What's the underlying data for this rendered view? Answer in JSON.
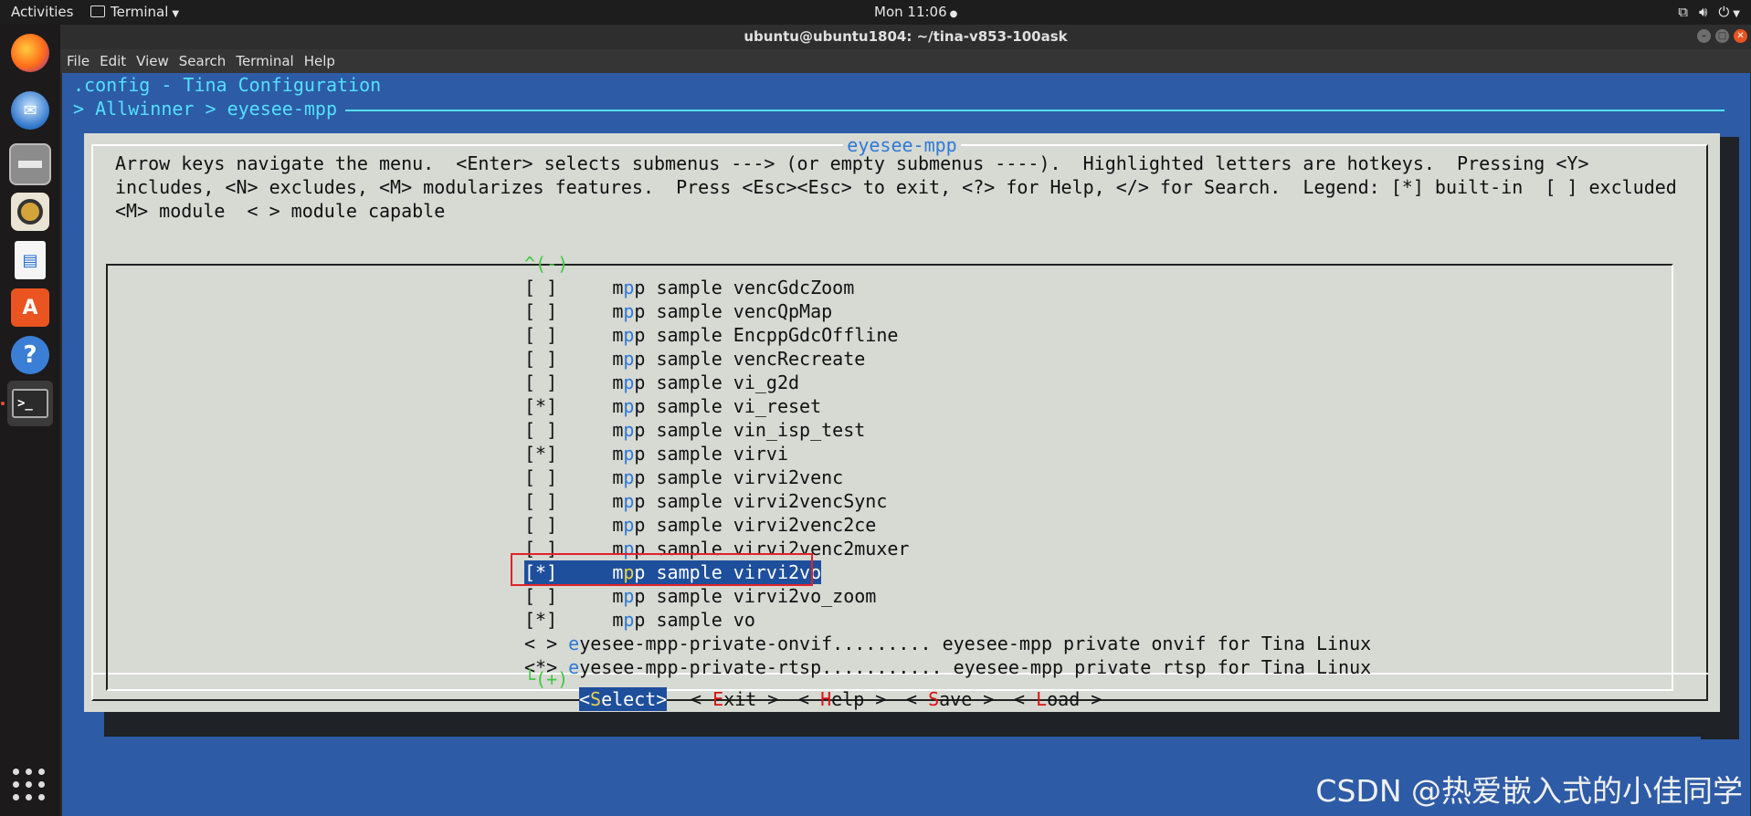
{
  "topbar": {
    "activities": "Activities",
    "app_name": "Terminal",
    "clock": "Mon 11:06",
    "tray": [
      "network-icon",
      "volume-icon",
      "power-icon"
    ]
  },
  "dock": {
    "items": [
      "firefox-icon",
      "thunderbird-icon",
      "files-icon",
      "rhythmbox-icon",
      "writer-icon",
      "software-icon",
      "help-icon",
      "terminal-icon"
    ]
  },
  "window": {
    "title": "ubuntu@ubuntu1804: ~/tina-v853-100ask",
    "menu": [
      "File",
      "Edit",
      "View",
      "Search",
      "Terminal",
      "Help"
    ]
  },
  "menuconfig": {
    "config_title": ".config - Tina Configuration",
    "breadcrumb": "> Allwinner > eyesee-mpp",
    "dialog_title": "eyesee-mpp",
    "help_lines": [
      "Arrow keys navigate the menu.  <Enter> selects submenus ---> (or empty submenus ----).  Highlighted letters are hotkeys.  Pressing <Y>",
      "includes, <N> excludes, <M> modularizes features.  Press <Esc><Esc> to exit, <?> for Help, </> for Search.  Legend: [*] built-in  [ ] excluded",
      "<M> module  < > module capable"
    ],
    "scroll_up": "^(-)",
    "scroll_down": "└(+)",
    "items": [
      {
        "mark": "[ ]",
        "pre": "     m",
        "hk": "p",
        "rest": "p sample vencGdcZoom"
      },
      {
        "mark": "[ ]",
        "pre": "     m",
        "hk": "p",
        "rest": "p sample vencQpMap"
      },
      {
        "mark": "[ ]",
        "pre": "     m",
        "hk": "p",
        "rest": "p sample EncppGdcOffline"
      },
      {
        "mark": "[ ]",
        "pre": "     m",
        "hk": "p",
        "rest": "p sample vencRecreate"
      },
      {
        "mark": "[ ]",
        "pre": "     m",
        "hk": "p",
        "rest": "p sample vi_g2d"
      },
      {
        "mark": "[*]",
        "pre": "     m",
        "hk": "p",
        "rest": "p sample vi_reset"
      },
      {
        "mark": "[ ]",
        "pre": "     m",
        "hk": "p",
        "rest": "p sample vin_isp_test"
      },
      {
        "mark": "[*]",
        "pre": "     m",
        "hk": "p",
        "rest": "p sample virvi"
      },
      {
        "mark": "[ ]",
        "pre": "     m",
        "hk": "p",
        "rest": "p sample virvi2venc"
      },
      {
        "mark": "[ ]",
        "pre": "     m",
        "hk": "p",
        "rest": "p sample virvi2vencSync"
      },
      {
        "mark": "[ ]",
        "pre": "     m",
        "hk": "p",
        "rest": "p sample virvi2venc2ce"
      },
      {
        "mark": "[ ]",
        "pre": "     m",
        "hk": "p",
        "rest": "p sample virvi2venc2muxer"
      },
      {
        "mark": "[*]",
        "pre": "     m",
        "hk": "p",
        "rest": "p sample virvi2vo",
        "selected": true
      },
      {
        "mark": "[ ]",
        "pre": "     m",
        "hk": "p",
        "rest": "p sample virvi2vo_zoom"
      },
      {
        "mark": "[*]",
        "pre": "     m",
        "hk": "p",
        "rest": "p sample vo"
      },
      {
        "mark": "< >",
        "pre": " ",
        "hk": "e",
        "rest": "yesee-mpp-private-onvif......... eyesee-mpp private onvif for Tina Linux"
      },
      {
        "mark": "<*>",
        "pre": " ",
        "hk": "e",
        "rest": "yesee-mpp-private-rtsp........... eyesee-mpp private rtsp for Tina Linux"
      }
    ],
    "buttons": [
      {
        "pre": "<",
        "hk": "S",
        "rest": "elect>",
        "selected": true
      },
      {
        "pre": "< ",
        "hk": "E",
        "rest": "xit >"
      },
      {
        "pre": "< ",
        "hk": "H",
        "rest": "elp >"
      },
      {
        "pre": "< ",
        "hk": "S",
        "rest": "ave >"
      },
      {
        "pre": "< ",
        "hk": "L",
        "rest": "oad >"
      }
    ]
  },
  "watermark": "CSDN @热爱嵌入式的小佳同学",
  "colors": {
    "terminal_bg": "#2d5ba6",
    "dialog_bg": "#d7d9d3",
    "hotkey": "#2e7ad6",
    "highlight_box": "#e1222a"
  }
}
